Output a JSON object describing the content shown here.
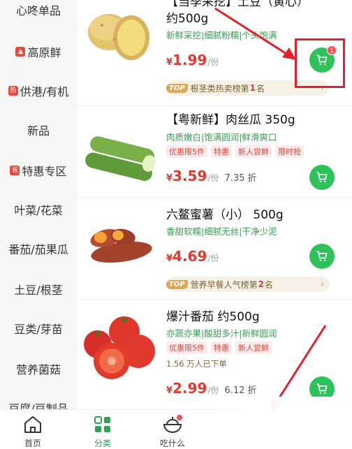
{
  "sidebar": {
    "items": [
      {
        "label": "心咚单品",
        "icon": ""
      },
      {
        "label": "高原鲜",
        "icon": "mountain-tag"
      },
      {
        "label": "供港/有机",
        "icon": "热"
      },
      {
        "label": "新品",
        "icon": ""
      },
      {
        "label": "特惠专区",
        "icon": "省"
      },
      {
        "label": "叶菜/花菜",
        "icon": ""
      },
      {
        "label": "番茄/茄果瓜",
        "icon": ""
      },
      {
        "label": "土豆/根茎",
        "icon": ""
      },
      {
        "label": "豆类/芽苗",
        "icon": ""
      },
      {
        "label": "营养菌菇",
        "icon": ""
      },
      {
        "label": "豆腐/豆制品",
        "icon": ""
      }
    ]
  },
  "products": [
    {
      "title_l1": "【当季采挖】土豆（黄心）",
      "title_l2": "约500g",
      "desc": "新鲜采挖|细腻粉糯|个头饱满",
      "currency": "¥",
      "price": "1.99",
      "unit": "/份",
      "cart_badge": "1",
      "rank_text_pre": "根茎类热卖榜第",
      "rank_num": "1",
      "rank_text_post": "名",
      "image": "potato"
    },
    {
      "title_l1": "【粤新鲜】肉丝瓜 350g",
      "desc": "肉质嫩白|饱满圆润|鲜滑爽口",
      "tags": [
        "优惠限5件",
        "特惠",
        "新人尝鲜",
        "限时抢"
      ],
      "currency": "¥",
      "price": "3.59",
      "unit": "/份",
      "discount": "7.35 折",
      "image": "loofah"
    },
    {
      "title_l1": "六鳌蜜薯（小） 500g",
      "desc": "香甜软糯|细腻无丝|干净少泥",
      "currency": "¥",
      "price": "4.69",
      "unit": "/份",
      "rank_text_pre": "营养早餐人气榜第",
      "rank_num": "2",
      "rank_text_post": "名",
      "image": "sweet-potato"
    },
    {
      "title_l1": "爆汁番茄 约500g",
      "desc": "亦蔬亦果|酸甜多汁|新鲜圆润",
      "tags": [
        "优惠限5件",
        "特惠",
        "新人尝鲜"
      ],
      "sold": "1.56 万人已下单",
      "currency": "¥",
      "price": "2.99",
      "unit": "/份",
      "discount": "6.12 折",
      "image": "tomato"
    }
  ],
  "rank_badge": "TOP",
  "tabbar": {
    "tabs": [
      {
        "label": "首页",
        "icon": "home-icon"
      },
      {
        "label": "分类",
        "icon": "category-icon",
        "active": true
      },
      {
        "label": "吃什么",
        "icon": "bowl-icon"
      }
    ]
  },
  "colors": {
    "accent_green": "#2ec25a",
    "price_red": "#e23a2e",
    "annotation_red": "#e5202a"
  }
}
